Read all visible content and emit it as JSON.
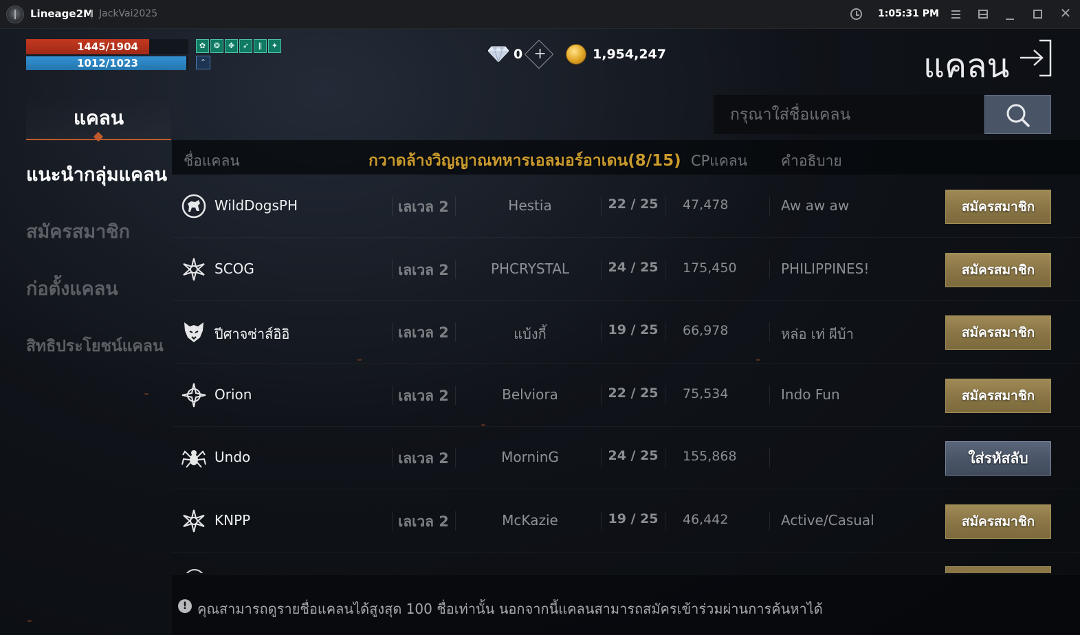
{
  "titlebar": {
    "app_name": "Lineage2M",
    "account": "JackVai2025",
    "time": "1:05:31 PM"
  },
  "status": {
    "hp": "1445/1904",
    "hp_fraction": 0.759,
    "mp": "1012/1023",
    "mp_fraction": 0.989,
    "buff_icons": [
      "leaf-buff",
      "swirl-buff",
      "wing-buff",
      "feather-buff",
      "rune-buff",
      "shield-buff"
    ],
    "buff_glyphs": [
      "✿",
      "❂",
      "✥",
      "➶",
      "ǁ",
      "✦"
    ],
    "special_buff_glyph": "⌃"
  },
  "currency": {
    "diamonds": "0",
    "gold": "1,954,247"
  },
  "screen_title": "แคลน",
  "tab": {
    "label": "แคลน"
  },
  "search": {
    "placeholder": "กรุณาใส่ชื่อแคลน"
  },
  "nav": [
    {
      "label": "แนะนำกลุ่มแคลน",
      "active": true
    },
    {
      "label": "สมัครสมาชิก",
      "active": false
    },
    {
      "label": "ก่อตั้งแคลน",
      "active": false
    },
    {
      "label": "สิทธิประโยชน์แคลน",
      "active": false
    }
  ],
  "table": {
    "headers": {
      "name": "ชื่อแคลน",
      "cp": "CPแคลน",
      "description": "คำอธิบาย"
    },
    "quest_banner": "กวาดล้างวิญญาณทหารเอลมอร์อาเดน(8/15)",
    "rows": [
      {
        "emblem": "dog-emblem",
        "name": "WildDogsPH",
        "level": "เลเวล 2",
        "leader": "Hestia",
        "members": "22 / 25",
        "cp": "47,478",
        "description": "Aw aw aw",
        "action": "สมัครสมาชิก",
        "action_type": "join"
      },
      {
        "emblem": "star-emblem",
        "name": "SCOG",
        "level": "เลเวล 2",
        "leader": "PHCRYSTAL",
        "members": "24 / 25",
        "cp": "175,450",
        "description": "PHILIPPINES!",
        "action": "สมัครสมาชิก",
        "action_type": "join"
      },
      {
        "emblem": "wolf-emblem",
        "name": "ปีศาจซ่าส์อิอิ",
        "level": "เลเวล 2",
        "leader": "แบ้งกี้",
        "members": "19 / 25",
        "cp": "66,978",
        "description": "หล่อ เท่ ผีบ้า",
        "action": "สมัครสมาชิก",
        "action_type": "join"
      },
      {
        "emblem": "compass-emblem",
        "name": "Orion",
        "level": "เลเวล 2",
        "leader": "Belviora",
        "members": "22 / 25",
        "cp": "75,534",
        "description": "Indo Fun",
        "action": "สมัครสมาชิก",
        "action_type": "join"
      },
      {
        "emblem": "spider-emblem",
        "name": "Undo",
        "level": "เลเวล 2",
        "leader": "MorninG",
        "members": "24 / 25",
        "cp": "155,868",
        "description": "",
        "action": "ใส่รหัสลับ",
        "action_type": "password"
      },
      {
        "emblem": "star-emblem",
        "name": "KNPP",
        "level": "เลเวล 2",
        "leader": "McKazie",
        "members": "19 / 25",
        "cp": "46,442",
        "description": "Active/Casual",
        "action": "สมัครสมาชิก",
        "action_type": "join"
      }
    ]
  },
  "footer": {
    "info_glyph": "!",
    "notice": "คุณสามารถดูรายชื่อแคลนได้สูงสุด 100 ชื่อเท่านั้น นอกจากนี้แคลนสามารถสมัครเข้าร่วมผ่านการค้นหาได้"
  },
  "colors": {
    "hp": "#c4381f",
    "mp": "#3392d4",
    "accent": "#c05a2c",
    "join_button": "#8a7646",
    "password_button": "#4a5567",
    "quest_text": "#c99a2e"
  }
}
